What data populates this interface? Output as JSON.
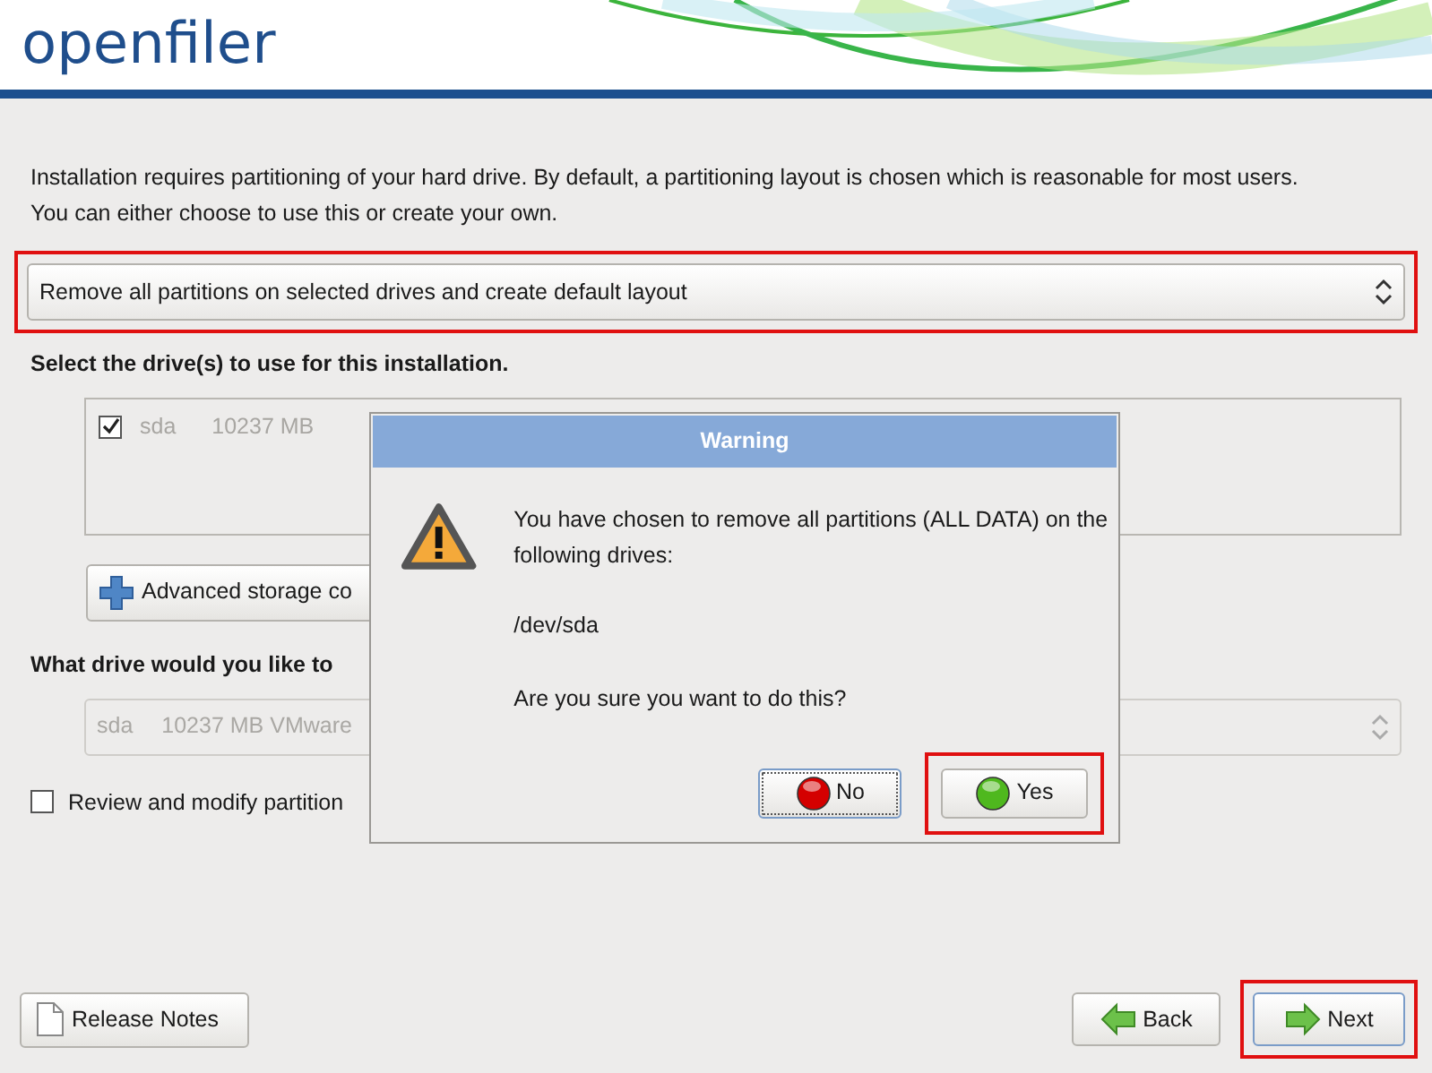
{
  "header": {
    "logo": "openfiler"
  },
  "intro": [
    "Installation requires partitioning of your hard drive.  By default, a partitioning layout is chosen which is reasonable for most users.",
    "You can either choose to use this or create your own."
  ],
  "layout_select": {
    "value": "Remove all partitions on selected drives and create default layout",
    "highlighted": true
  },
  "drives_heading": "Select the drive(s) to use for this installation.",
  "drives": [
    {
      "name": "sda",
      "size": "10237 MB",
      "checked": true
    }
  ],
  "advanced_button": {
    "label": "Advanced storage co"
  },
  "boot_heading": "What drive would you like to",
  "boot_select": {
    "name": "sda",
    "value": "10237 MB VMware",
    "disabled": true
  },
  "review_checkbox": {
    "label": "Review and modify partition",
    "checked": false
  },
  "dialog": {
    "title": "Warning",
    "message": "You have chosen to remove all partitions (ALL DATA) on the following drives:",
    "device": "/dev/sda",
    "question": "Are you sure you want to do this?",
    "buttons": [
      {
        "kind": "no",
        "label": "No",
        "focused": true,
        "highlighted": false
      },
      {
        "kind": "yes",
        "label": "Yes",
        "focused": false,
        "highlighted": true
      }
    ]
  },
  "footer": {
    "release_notes": {
      "label": "Release Notes"
    },
    "buttons": [
      {
        "kind": "back",
        "label": "Back",
        "highlighted": false
      },
      {
        "kind": "next",
        "label": "Next",
        "highlighted": true
      }
    ]
  }
}
